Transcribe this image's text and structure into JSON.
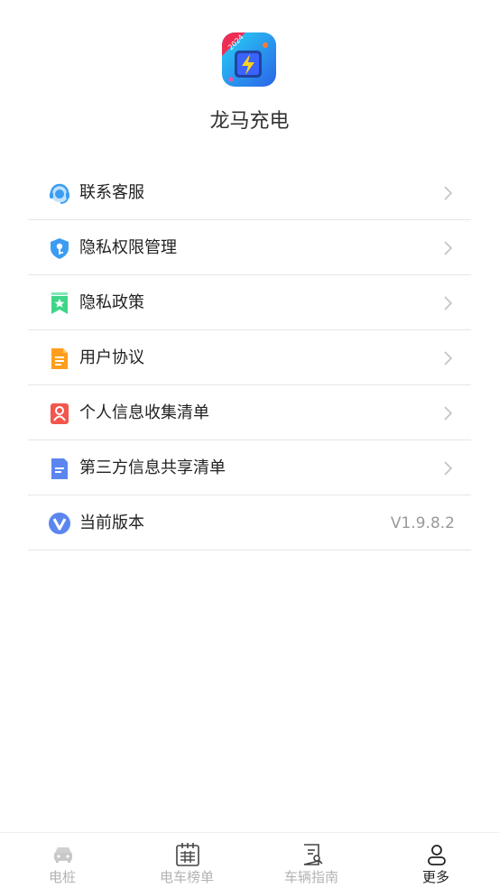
{
  "app": {
    "name": "龙马充电",
    "icon_badge": "2024",
    "icon": "lightning-battery-icon"
  },
  "menu": [
    {
      "label": "联系客服",
      "icon": "customer-service-icon",
      "color": "#3b9cf2"
    },
    {
      "label": "隐私权限管理",
      "icon": "shield-key-icon",
      "color": "#3b9cf2"
    },
    {
      "label": "隐私政策",
      "icon": "bookmark-star-icon",
      "color": "#3fd68a"
    },
    {
      "label": "用户协议",
      "icon": "document-icon",
      "color": "#ff9d1c"
    },
    {
      "label": "个人信息收集清单",
      "icon": "person-card-icon",
      "color": "#f2564d"
    },
    {
      "label": "第三方信息共享清单",
      "icon": "file-list-icon",
      "color": "#5b86f0"
    },
    {
      "label": "当前版本",
      "icon": "version-v-icon",
      "color": "#5b86f0",
      "value": "V1.9.8.2"
    }
  ],
  "tabs": [
    {
      "label": "电桩",
      "icon": "car-icon",
      "active": false
    },
    {
      "label": "电车榜单",
      "icon": "calendar-grid-icon",
      "active": false
    },
    {
      "label": "车辆指南",
      "icon": "guide-doc-icon",
      "active": false
    },
    {
      "label": "更多",
      "icon": "person-icon",
      "active": true
    }
  ]
}
